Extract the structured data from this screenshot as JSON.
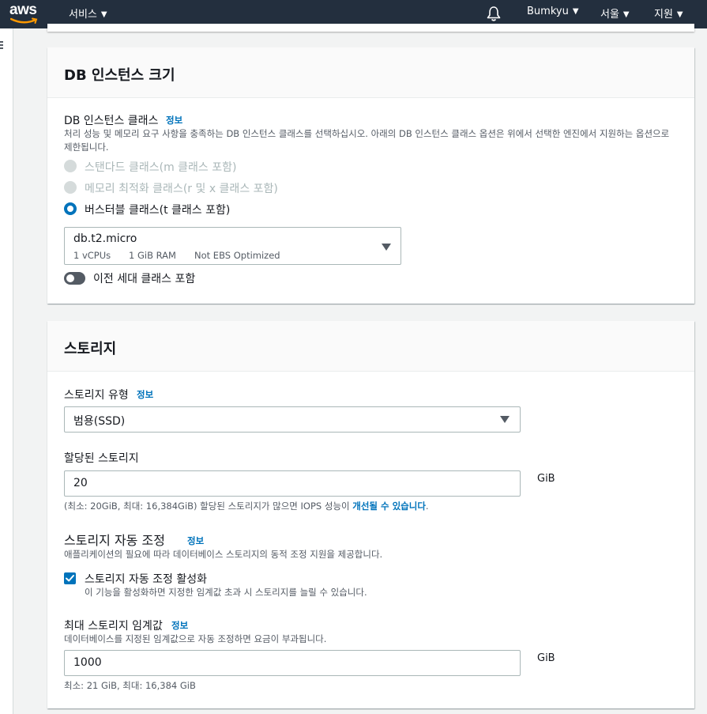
{
  "nav": {
    "logo": "aws",
    "services": "서비스",
    "user": "Bumkyu",
    "region": "서울",
    "support": "지원"
  },
  "instance_card": {
    "title": "DB 인스턴스 크기",
    "class_label": "DB 인스턴스 클래스",
    "info": "정보",
    "description": "처리 성능 및 메모리 요구 사항을 충족하는 DB 인스턴스 클래스를 선택하십시오. 아래의 DB 인스턴스 클래스 옵션은 위에서 선택한 엔진에서 지원하는 옵션으로 제한됩니다.",
    "options": [
      {
        "label": "스탠다드 클래스(m 클래스 포함)",
        "state": "disabled"
      },
      {
        "label": "메모리 최적화 클래스(r 및 x 클래스 포함)",
        "state": "disabled"
      },
      {
        "label": "버스터블 클래스(t 클래스 포함)",
        "state": "selected"
      }
    ],
    "selected_instance": {
      "name": "db.t2.micro",
      "vcpu": "1 vCPUs",
      "ram": "1 GiB RAM",
      "ebs": "Not EBS Optimized"
    },
    "previous_gen_toggle": "이전 세대 클래스 포함"
  },
  "storage_card": {
    "title": "스토리지",
    "type_label": "스토리지 유형",
    "info": "정보",
    "type_value": "범용(SSD)",
    "allocated_label": "할당된 스토리지",
    "allocated_value": "20",
    "unit": "GiB",
    "allocated_hint_pre": "(최소: 20GiB, 최대: 16,384GiB) 할당된 스토리지가 많으면 IOPS 성능이 ",
    "allocated_hint_link": "개선될 수 있습니다",
    "allocated_hint_post": ".",
    "autoscaling_title": "스토리지 자동 조정",
    "autoscaling_desc": "애플리케이션의 필요에 따라 데이터베이스 스토리지의 동적 조정 지원을 제공합니다.",
    "autoscaling_checkbox": "스토리지 자동 조정 활성화",
    "autoscaling_checkbox_desc": "이 기능을 활성화하면 지정한 임계값 초과 시 스토리지를 늘릴 수 있습니다.",
    "max_threshold_label": "최대 스토리지 임계값",
    "max_threshold_desc": "데이터베이스를 지정된 임계값으로 자동 조정하면 요금이 부과됩니다.",
    "max_threshold_value": "1000",
    "max_threshold_hint": "최소: 21 GiB, 최대: 16,384 GiB"
  }
}
